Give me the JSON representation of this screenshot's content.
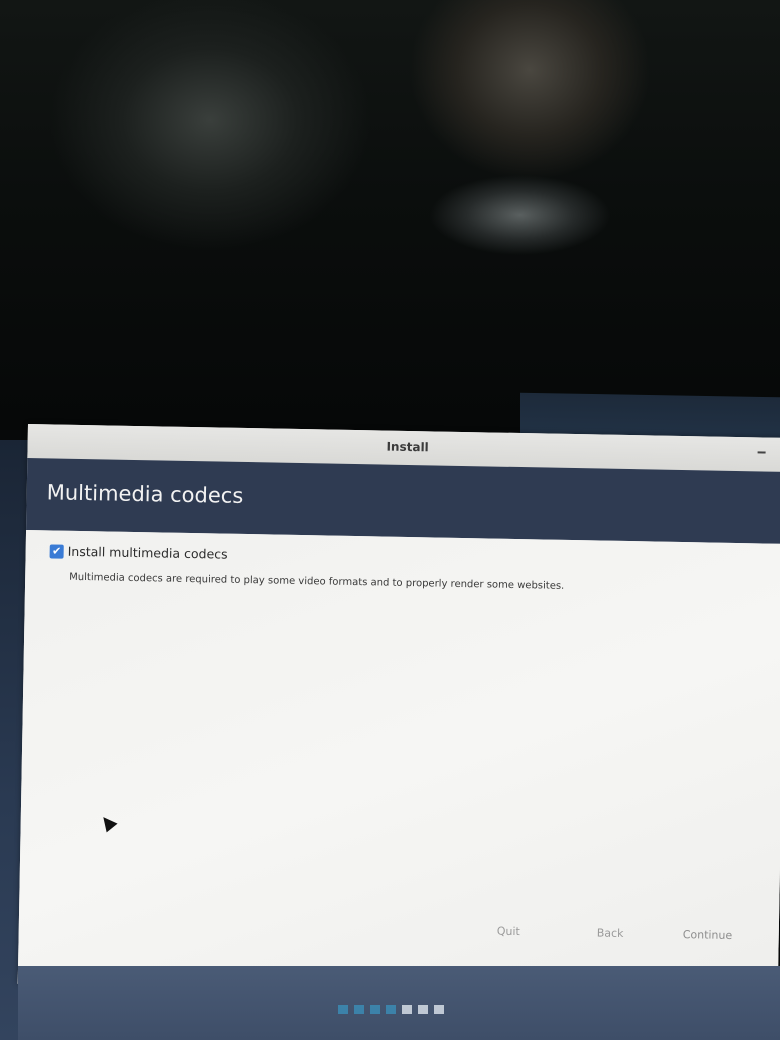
{
  "window": {
    "title": "Install"
  },
  "header": {
    "heading": "Multimedia codecs"
  },
  "content": {
    "checkbox_label": "Install multimedia codecs",
    "checkbox_checked": true,
    "description": "Multimedia codecs are required to play some video formats and to properly render some websites."
  },
  "buttons": {
    "quit": "Quit",
    "back": "Back",
    "continue": "Continue"
  },
  "progress": {
    "total_steps": 7,
    "completed_steps": 4
  },
  "colors": {
    "header_bg": "#2f3b52",
    "checkbox_accent": "#3a7bd5",
    "progress_done": "#3b8fb8",
    "progress_pending": "#dfe6ee"
  }
}
